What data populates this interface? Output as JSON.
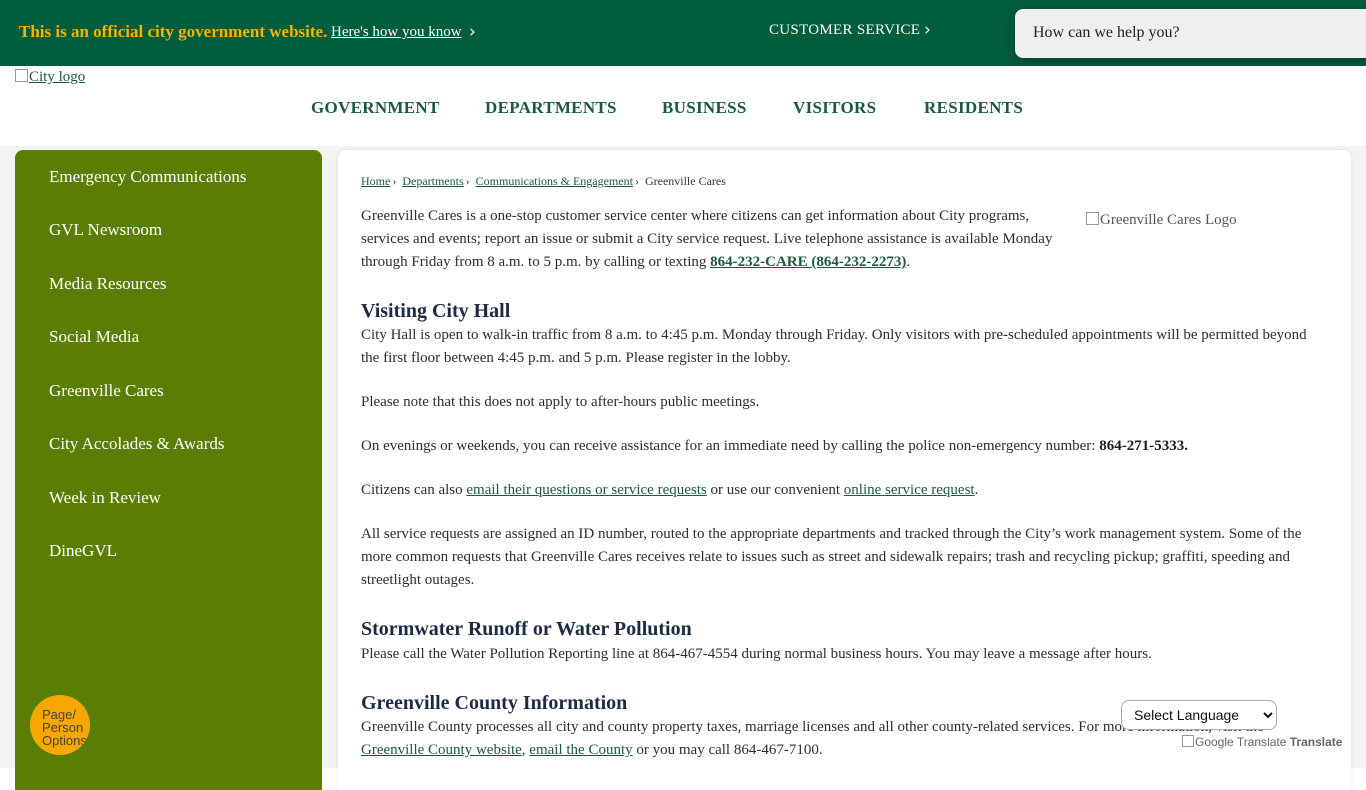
{
  "topbar": {
    "official_text": "This is an official city government website.",
    "how_you_know": "Here's how you know",
    "customer_service": "CUSTOMER SERVICE",
    "search_placeholder": "How can we help you?"
  },
  "header": {
    "logo_alt": "City logo",
    "nav": [
      "GOVERNMENT",
      "DEPARTMENTS",
      "BUSINESS",
      "VISITORS",
      "RESIDENTS"
    ]
  },
  "sidebar": {
    "items": [
      "Emergency Communications",
      "GVL Newsroom",
      "Media Resources",
      "Social Media",
      "Greenville Cares",
      "City Accolades & Awards",
      "Week in Review",
      "DineGVL"
    ]
  },
  "breadcrumb": {
    "home": "Home",
    "departments": " Departments",
    "comms": " Communications & Engagement",
    "current": "Greenville Cares"
  },
  "content": {
    "logo_alt": "Greenville Cares Logo",
    "intro_1": "Greenville Cares is a one-stop customer service center where citizens can get information about City programs,",
    "intro_2": "services and events; report an issue or submit a City service request. Live telephone assistance is available Monday",
    "intro_3": "through Friday from 8 a.m. to 5 p.m. by calling or texting ",
    "intro_phone": "864-232-CARE (864-232-2273)",
    "intro_end": ".",
    "h_visiting": "Visiting City Hall",
    "visit_1": "City Hall is open to walk-in traffic from 8 a.m. to 4:45 p.m. Monday through Friday. Only visitors with pre-scheduled appointments will be permitted beyond",
    "visit_2": "the first floor between 4:45 p.m. and 5 p.m. Please register in the lobby.",
    "note": "Please note that this does not apply to after-hours public meetings.",
    "evenings": "On evenings or weekends, you can receive assistance for an immediate need by calling the police non-emergency number: ",
    "police_number": "864-271-5333.",
    "citizens_1": "Citizens can also ",
    "email_link": "email their questions or service requests",
    "citizens_2": " or use our convenient ",
    "online_link": "online service request",
    "citizens_3": ".",
    "requests_1": "All service requests are assigned an ID number, routed to the appropriate departments and tracked through the City’s work management system. Some of the",
    "requests_2": "more common requests that Greenville Cares receives relate to issues such as street and sidewalk repairs; trash and recycling pickup; graffiti, speeding and",
    "requests_3": "streetlight outages.",
    "h_storm": "Stormwater Runoff or Water Pollution",
    "storm": "Please call the Water Pollution Reporting line at 864-467-4554 during normal business hours. You may leave a message after hours.",
    "h_county": "Greenville County Information",
    "county_1": "Greenville County processes all city and county property taxes, marriage licenses and all other county-related services. For more information, visit the",
    "county_link": "Greenville County website",
    "county_sep": ", ",
    "county_email": "email the County",
    "county_end": " or you may call 864-467-7100."
  },
  "widgets": {
    "page_tools": "Page/ Person Options",
    "language": "Select Language",
    "translate": "Google Translate",
    "translate_word": "Translate"
  },
  "colors": {
    "topbar": "#005e3c",
    "official_gold": "#f4b300",
    "sidebar_green": "#5a7e03",
    "nav_green": "#1b5a3a",
    "page_tools_orange": "#f6a800"
  }
}
